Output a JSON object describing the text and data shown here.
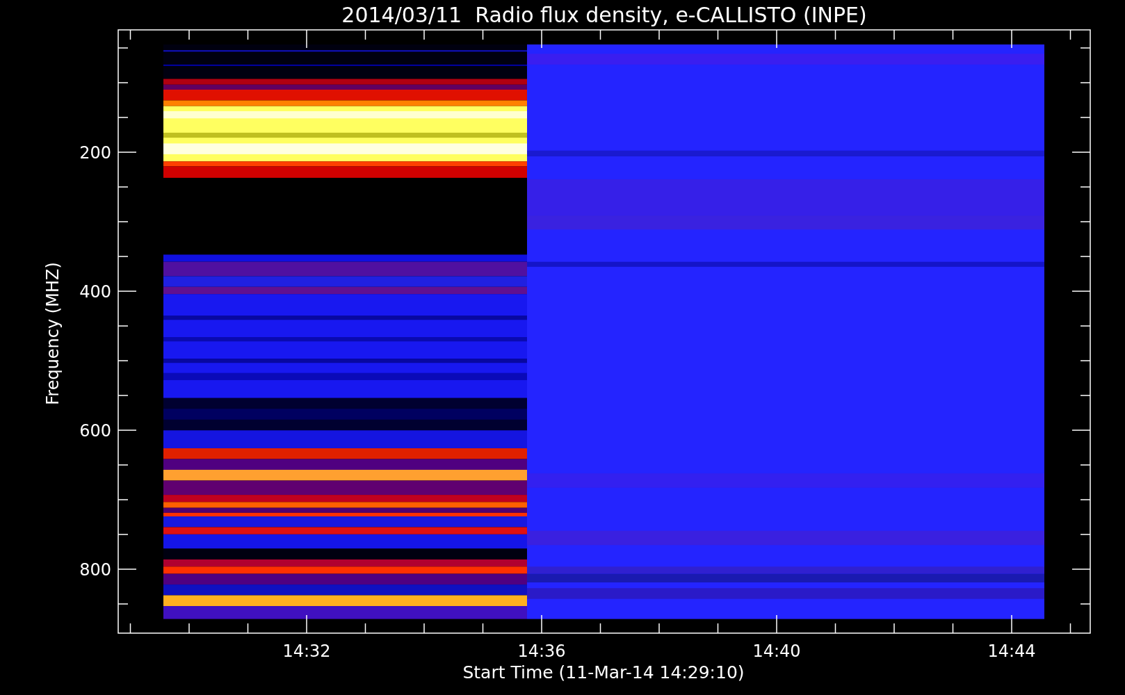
{
  "plot": {
    "title": "2014/03/11  Radio flux density, e-CALLISTO (INPE)",
    "ylabel": "Frequency (MHZ)",
    "xlabel": "Start Time (11-Mar-14 14:29:10)",
    "yticks": [
      "200",
      "400",
      "600",
      "800"
    ],
    "xticks": [
      "14:32",
      "14:36",
      "14:40",
      "14:44"
    ]
  }
}
